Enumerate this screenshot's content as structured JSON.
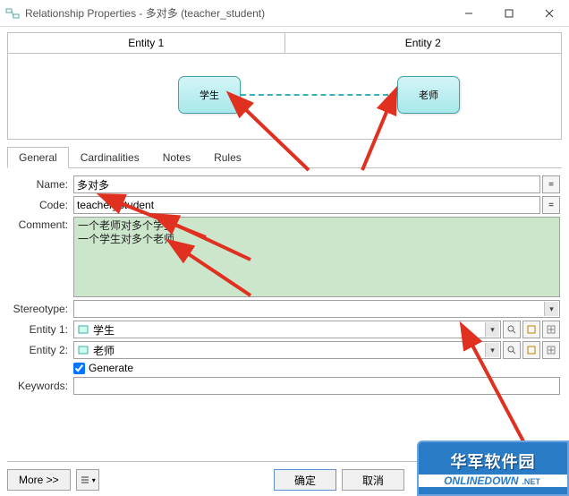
{
  "window": {
    "title": "Relationship Properties - 多对多 (teacher_student)"
  },
  "diagram": {
    "col1": "Entity 1",
    "col2": "Entity 2",
    "left_entity": "学生",
    "right_entity": "老师"
  },
  "tabs": {
    "t1": "General",
    "t2": "Cardinalities",
    "t3": "Notes",
    "t4": "Rules"
  },
  "form": {
    "name_label": "Name:",
    "name_value": "多对多",
    "code_label": "Code:",
    "code_value": "teacher_student",
    "comment_label": "Comment:",
    "comment_value": "一个老师对多个学生\n一个学生对多个老师",
    "stereotype_label": "Stereotype:",
    "stereotype_value": "",
    "entity1_label": "Entity 1:",
    "entity1_value": "学生",
    "entity2_label": "Entity 2:",
    "entity2_value": "老师",
    "generate_label": "Generate",
    "keywords_label": "Keywords:",
    "keywords_value": "",
    "eq_btn": "="
  },
  "buttons": {
    "more": "More >>",
    "ok": "确定",
    "cancel": "取消"
  },
  "watermark": {
    "cn": "华军软件园",
    "en": "ONLINEDOWN",
    "net": ".NET"
  },
  "icons": {
    "entity": "entity-icon"
  }
}
